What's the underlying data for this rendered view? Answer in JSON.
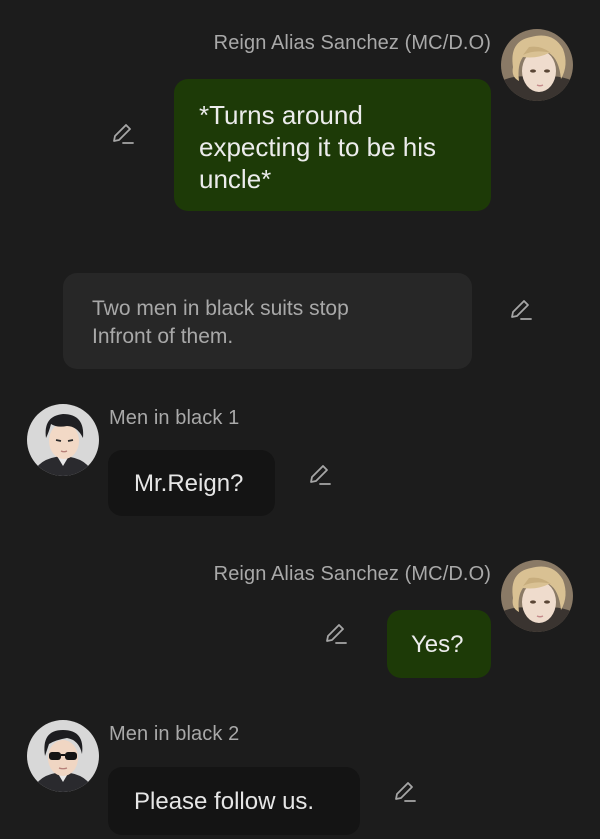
{
  "messages": [
    {
      "sender": "Reign Alias Sanchez (MC/D.O)",
      "text": "*Turns around expecting it to be his uncle*",
      "icon": "pencil-edit-icon"
    },
    {
      "text": "Two men in black suits stop Infront of them.",
      "icon": "pencil-edit-icon"
    },
    {
      "sender": "Men in black 1",
      "text": "Mr.Reign?",
      "icon": "pencil-edit-icon"
    },
    {
      "sender": "Reign Alias Sanchez (MC/D.O)",
      "text": "Yes?",
      "icon": "pencil-edit-icon"
    },
    {
      "sender": "Men in black 2",
      "text": "Please follow us.",
      "icon": "pencil-edit-icon"
    }
  ],
  "colors": {
    "background": "#1c1c1c",
    "user_bubble": "#1d3a07",
    "character_bubble": "#141414",
    "narration_bubble": "#272727",
    "name_text": "#a9a9a9"
  }
}
